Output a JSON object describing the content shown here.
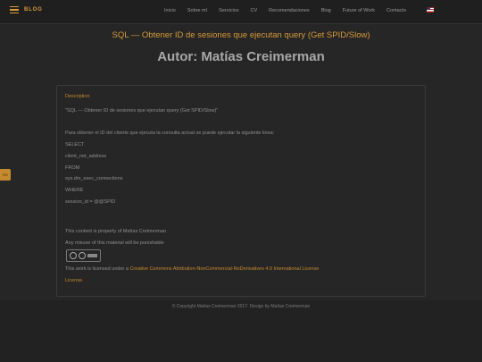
{
  "header": {
    "brand": "BLOG",
    "nav": [
      "Inicio",
      "Sobre mí",
      "Servicios",
      "CV",
      "Recomendaciones",
      "Blog",
      "Future of Work",
      "Contacto"
    ],
    "language_flag": "us-flag-icon"
  },
  "page_title": "SQL — Obtener ID de sesiones que ejecutan query (Get SPID/Slow)",
  "author_heading": "Autor: Matías Creimerman",
  "side_tab": "ES",
  "card": {
    "section_label": "Description",
    "query_title": "\"SQL — Obtener ID de sesiones que ejecutan query (Get SPID/Slow)\"",
    "intro": "Para obtener el ID del cliente que ejecuta la consulta actual se puede ejecutar la siguiente linea:",
    "code": [
      "SELECT",
      "client_net_address",
      "FROM",
      "sys.dm_exec_connections",
      "WHERE",
      "session_id = @@SPID"
    ],
    "notice1": "This content is property of Matías Creimerman",
    "notice2": "Any misuse of this material will be punishable",
    "license_prefix": "This work is licensed under a",
    "license_link_a": "Creative Commons Attribution-NonCommercial-NoDerivatives 4.0 International License",
    "license_link_b": "License."
  },
  "footer": {
    "text": "© Copyright Matías Creimerman 2017. Design by Matías Creimerman"
  },
  "colors": {
    "accent": "#d99a3a",
    "background": "#262626"
  }
}
